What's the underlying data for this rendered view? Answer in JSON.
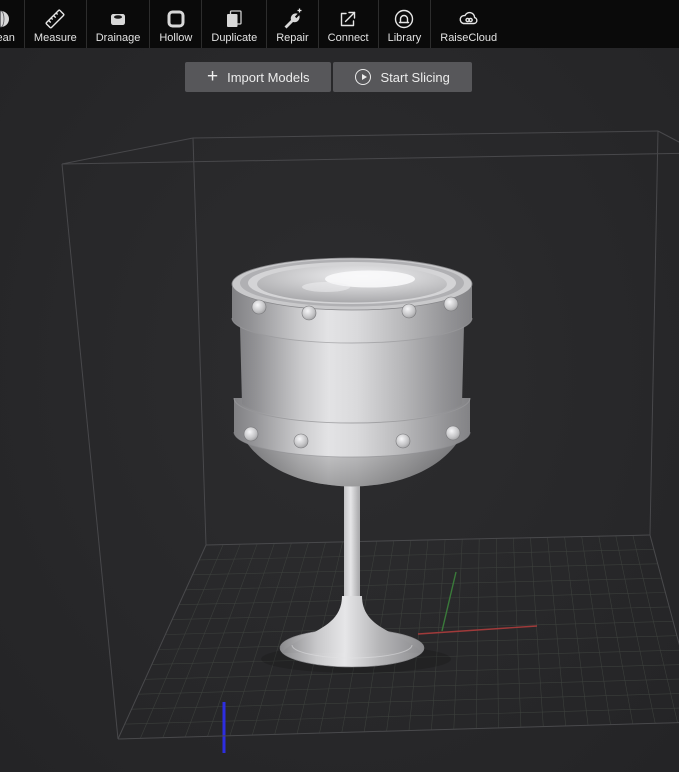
{
  "toolbar": {
    "items": [
      {
        "label": "olean",
        "icon": "boolean-sphere-icon"
      },
      {
        "label": "Measure",
        "icon": "measure-ruler-icon"
      },
      {
        "label": "Drainage",
        "icon": "drainage-icon"
      },
      {
        "label": "Hollow",
        "icon": "hollow-cube-icon"
      },
      {
        "label": "Duplicate",
        "icon": "duplicate-icon"
      },
      {
        "label": "Repair",
        "icon": "repair-wrench-icon"
      },
      {
        "label": "Connect",
        "icon": "connect-arrow-icon"
      },
      {
        "label": "Library",
        "icon": "library-icon"
      },
      {
        "label": "RaiseCloud",
        "icon": "raisecloud-cloud-icon"
      }
    ]
  },
  "actions": {
    "import_models": "Import Models",
    "start_slicing": "Start Slicing"
  },
  "viewport": {
    "background_color": "#28282a",
    "grid_color": "#3e423e",
    "wireframe_color": "#4a4a4d",
    "axis_colors": {
      "x": "#a03a3a",
      "y": "#3a7a3a",
      "z": "#2d2de0"
    },
    "model": "goblet-with-rivets",
    "model_color": "#d6d6d8"
  }
}
